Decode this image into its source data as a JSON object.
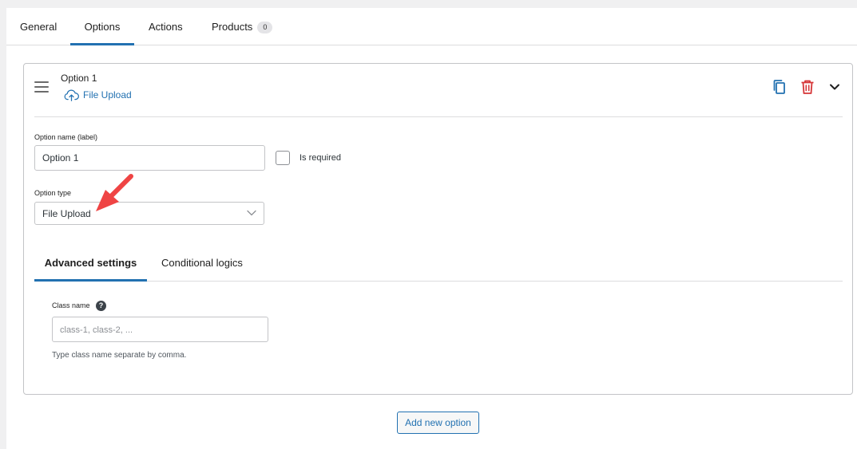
{
  "tabs": [
    {
      "label": "General"
    },
    {
      "label": "Options",
      "active": true
    },
    {
      "label": "Actions"
    },
    {
      "label": "Products",
      "badge": "0"
    }
  ],
  "option": {
    "title": "Option 1",
    "type_label": "File Upload",
    "type_icon": "cloud-upload-icon",
    "actions": [
      "copy-icon",
      "trash-icon",
      "chevron-down-icon"
    ],
    "name_label": "Option name (label)",
    "name_value": "Option 1",
    "required_label": "Is required",
    "required_checked": false,
    "type_field_label": "Option type",
    "type_value": "File Upload"
  },
  "subtabs": [
    {
      "label": "Advanced settings",
      "active": true
    },
    {
      "label": "Conditional logics"
    }
  ],
  "advanced": {
    "class_label": "Class name",
    "help_glyph": "?",
    "class_placeholder": "class-1, class-2, ...",
    "class_value": "",
    "hint": "Type class name separate by comma."
  },
  "add_button": "Add new option",
  "colors": {
    "accent": "#2271b1",
    "danger": "#d63638",
    "annotation_arrow": "#ef4444"
  }
}
